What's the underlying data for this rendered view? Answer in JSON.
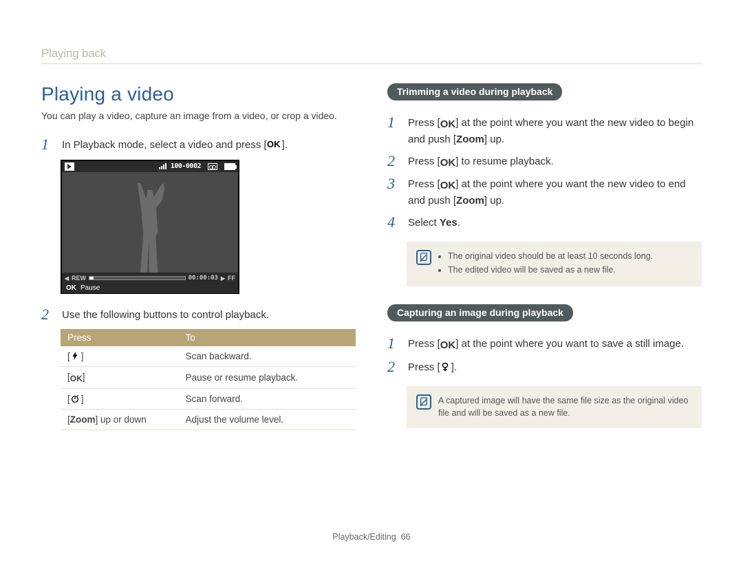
{
  "breadcrumb": "Playing back",
  "left": {
    "title": "Playing a video",
    "intro": "You can play a video, capture an image from a video, or crop a video.",
    "steps": {
      "1": {
        "num": "1",
        "pre": "In Playback mode, select a video and press [",
        "post": "]."
      },
      "2": {
        "num": "2",
        "text": "Use the following buttons to control playback."
      }
    },
    "screen": {
      "file_index": "100-0002",
      "time": "00:00:03",
      "rew": "REW",
      "ff": "FF",
      "ok": "OK",
      "pause": "Pause"
    },
    "table": {
      "head_press": "Press",
      "head_to": "To",
      "rows": [
        {
          "press_open": "[",
          "press_icon": "flash",
          "press_close": "]",
          "to": "Scan backward."
        },
        {
          "press_open": "[",
          "press_icon": "ok",
          "press_close": "]",
          "to": "Pause or resume playback."
        },
        {
          "press_open": "[",
          "press_icon": "timer",
          "press_close": "]",
          "to": "Scan forward."
        },
        {
          "press_text": "[Zoom] up or down",
          "to": "Adjust the volume level."
        }
      ]
    }
  },
  "right": {
    "trim": {
      "pill": "Trimming a video during playback",
      "steps": {
        "1": {
          "num": "1",
          "pre": "Press [",
          "mid": "] at the point where you want the new video to begin and push [",
          "bold": "Zoom",
          "post": "] up."
        },
        "2": {
          "num": "2",
          "pre": "Press [",
          "post": "] to resume playback."
        },
        "3": {
          "num": "3",
          "pre": "Press [",
          "mid": "] at the point where you want the new video to end and push [",
          "bold": "Zoom",
          "post": "] up."
        },
        "4": {
          "num": "4",
          "pre": "Select ",
          "bold": "Yes",
          "post": "."
        }
      },
      "note1": "The original video should be at least 10 seconds long.",
      "note2": "The edited video will be saved as a new file."
    },
    "capture": {
      "pill": "Capturing an image during playback",
      "steps": {
        "1": {
          "num": "1",
          "pre": "Press [",
          "post": "] at the point where you want to save a still image."
        },
        "2": {
          "num": "2",
          "pre": "Press [",
          "post": "]."
        }
      },
      "note": "A captured image will have the same file size as the original video file and will be saved as a new file."
    }
  },
  "footer": {
    "section": "Playback/Editing",
    "page": "66"
  },
  "glyph": {
    "ok": "OK"
  }
}
